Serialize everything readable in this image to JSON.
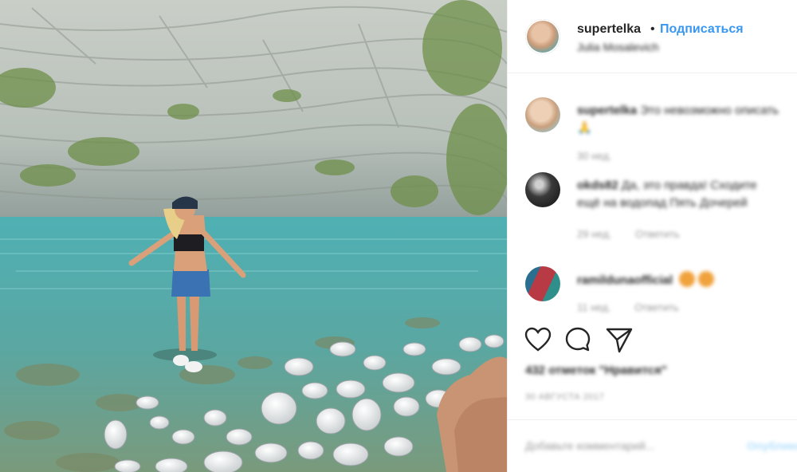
{
  "photo": {
    "icon": "photo"
  },
  "post": {
    "username": "supertelka",
    "separator": "•",
    "follow_label": "Подписаться",
    "location": "Julia Mosalevich"
  },
  "comments": [
    {
      "username": "supertelka",
      "text": "Это невозможно описать",
      "line2": "🙏",
      "meta_time": "30 нед.",
      "meta_reply": ""
    },
    {
      "username": "okds82",
      "text": "Да, это правда! Сходите",
      "line2": "ещё на водопад Пять Дочерей",
      "meta_time": "29 нед.",
      "meta_reply": "Ответить"
    },
    {
      "username": "ramildunaofficial",
      "text": "",
      "line2": "",
      "meta_time": "11 нед.",
      "meta_reply": "Ответить"
    }
  ],
  "actions": {
    "like_icon": "heart-icon",
    "comment_icon": "comment-icon",
    "share_icon": "share-icon"
  },
  "likes_text": "432 отметок \"Нравится\"",
  "date_text": "30 АВГУСТА 2017",
  "composer": {
    "placeholder": "Добавьте комментарий...",
    "post_label": "Опубликовать"
  },
  "colors": {
    "accent": "#3897f0",
    "text": "#262626",
    "muted": "#999999",
    "border": "#efefef"
  }
}
